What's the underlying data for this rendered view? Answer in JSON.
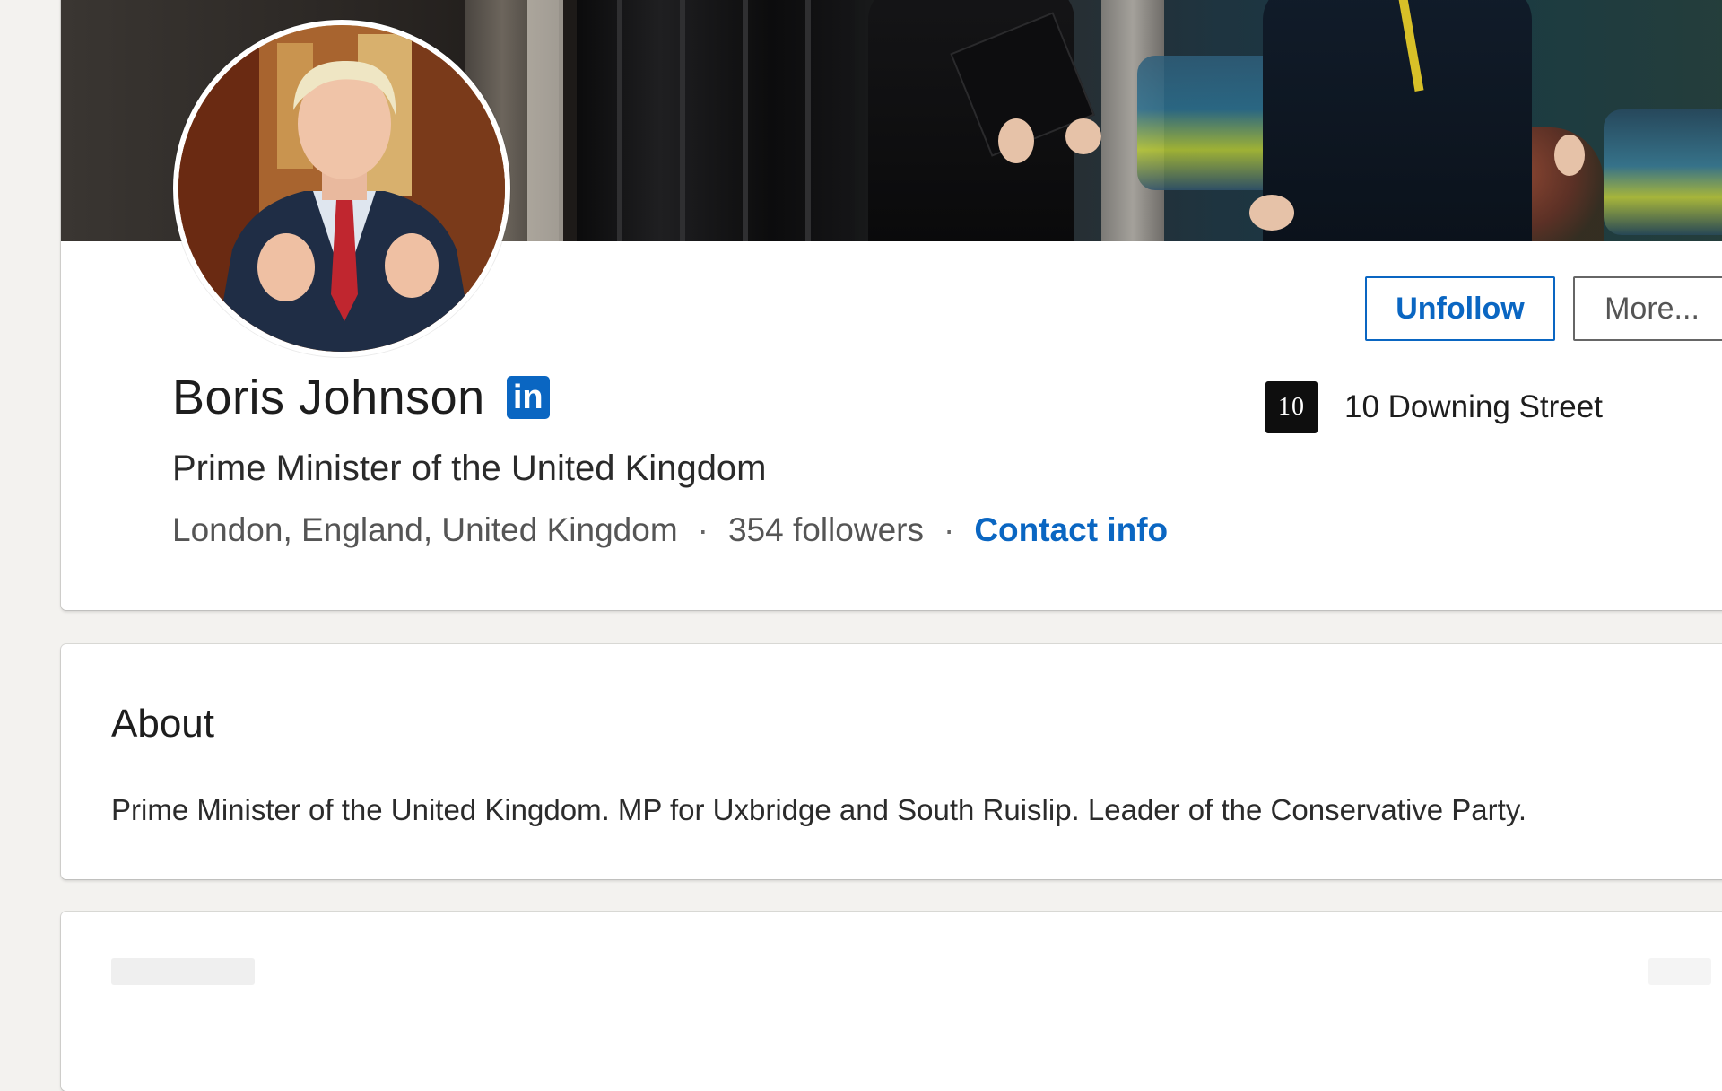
{
  "profile": {
    "name": "Boris Johnson",
    "headline": "Prime Minister of the United Kingdom",
    "location": "London, England, United Kingdom",
    "followers": "354 followers",
    "contact_info": "Contact info",
    "separator": "·",
    "badge_label": "in"
  },
  "actions": {
    "unfollow_label": "Unfollow",
    "more_label": "More..."
  },
  "company": {
    "name": "10 Downing Street",
    "logo_text": "10"
  },
  "about": {
    "title": "About",
    "text": "Prime Minister of the United Kingdom. MP for Uxbridge and South Ruislip. Leader of the Conservative Party."
  },
  "colors": {
    "accent": "#0a66c2",
    "page_background": "#f3f2ef",
    "card_background": "#ffffff"
  }
}
